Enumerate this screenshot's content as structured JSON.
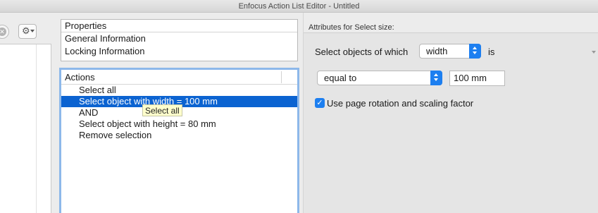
{
  "window": {
    "title": "Enfocus Action List Editor - Untitled"
  },
  "toolbar": {
    "clear_glyph": "✕",
    "gear_glyph": "⚙"
  },
  "properties": {
    "header": "Properties",
    "items": [
      "General Information",
      "Locking Information"
    ]
  },
  "actions": {
    "header": "Actions",
    "items": [
      {
        "label": "Select all",
        "selected": false
      },
      {
        "label": "Select object with width = 100 mm",
        "selected": true
      },
      {
        "label": "AND",
        "selected": false
      },
      {
        "label": "Select object with height = 80 mm",
        "selected": false
      },
      {
        "label": "Remove selection",
        "selected": false
      }
    ],
    "tooltip": "Select all"
  },
  "attributes": {
    "title": "Attributes for Select size:",
    "select_label": "Select objects of which",
    "dimension_value": "width",
    "is_label": "is",
    "comparison_value": "equal to",
    "size_value": "100 mm",
    "checkbox_label": "Use page rotation and scaling factor",
    "checkbox_checked": true
  },
  "colors": {
    "selection": "#0b63d1",
    "accent": "#1d7ff0",
    "focus_ring": "#8db8ea"
  }
}
